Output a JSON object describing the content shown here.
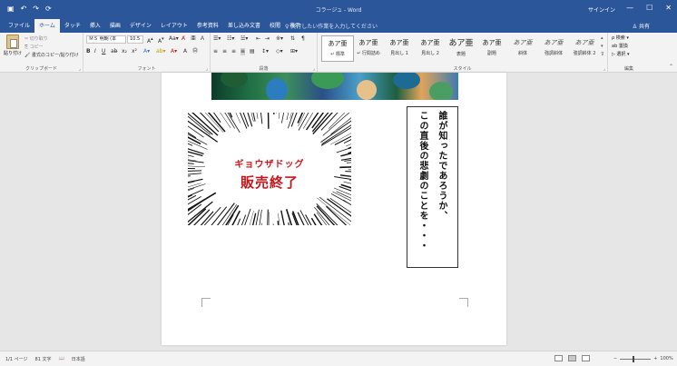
{
  "window": {
    "title": "コラージュ - Word",
    "signin": "サインイン",
    "minimize": "—",
    "restore": "☐",
    "close": "✕"
  },
  "qat": {
    "save": "▣",
    "undo": "↶",
    "redo": "↷",
    "extra": "⟳"
  },
  "tabs": [
    {
      "label": "ファイル",
      "active": false
    },
    {
      "label": "ホーム",
      "active": true
    },
    {
      "label": "タッチ",
      "active": false
    },
    {
      "label": "挿入",
      "active": false
    },
    {
      "label": "描画",
      "active": false
    },
    {
      "label": "デザイン",
      "active": false
    },
    {
      "label": "レイアウト",
      "active": false
    },
    {
      "label": "参考資料",
      "active": false
    },
    {
      "label": "差し込み文書",
      "active": false
    },
    {
      "label": "校閲",
      "active": false
    },
    {
      "label": "表示",
      "active": false
    }
  ],
  "tellme": "♀ 実行したい作業を入力してください",
  "share": "共有",
  "clipboard": {
    "paste": "貼り付け",
    "cut": "✂ 切り取り",
    "copy": "⎘ コピー",
    "format_painter": "🖌 書式のコピー/貼り付け",
    "label": "クリップボード"
  },
  "font": {
    "name": "ＭＳ 明朝 (本",
    "size": "10.5",
    "label": "フォント"
  },
  "paragraph": {
    "label": "段落"
  },
  "styles": {
    "label": "スタイル",
    "items": [
      {
        "preview": "あア亜",
        "name": "↵ 標準",
        "active": true
      },
      {
        "preview": "あア亜",
        "name": "↵ 行間詰め",
        "active": false
      },
      {
        "preview": "あア亜",
        "name": "見出し 1",
        "active": false
      },
      {
        "preview": "あア亜",
        "name": "見出し 2",
        "active": false
      },
      {
        "preview": "あア亜",
        "name": "表題",
        "active": false
      },
      {
        "preview": "あア亜",
        "name": "副題",
        "active": false
      },
      {
        "preview": "あア亜",
        "name": "斜体",
        "active": false
      },
      {
        "preview": "あア亜",
        "name": "強調斜体",
        "active": false
      },
      {
        "preview": "あア亜",
        "name": "強調斜体 2",
        "active": false
      }
    ]
  },
  "editing": {
    "label": "編集",
    "find": "ρ 検索 ▾",
    "replace": "ab 置換",
    "select": "▷ 選択 ▾"
  },
  "document": {
    "burst_title": "ギョウザドッグ",
    "burst_main": "販売終了",
    "vertical_col1": "誰が知ったであろうか、",
    "vertical_col2": "この直後の悲劇のことを・・・"
  },
  "status": {
    "page": "1/1 ページ",
    "words": "81 文字",
    "lang": "日本語",
    "zoom": "100%"
  }
}
